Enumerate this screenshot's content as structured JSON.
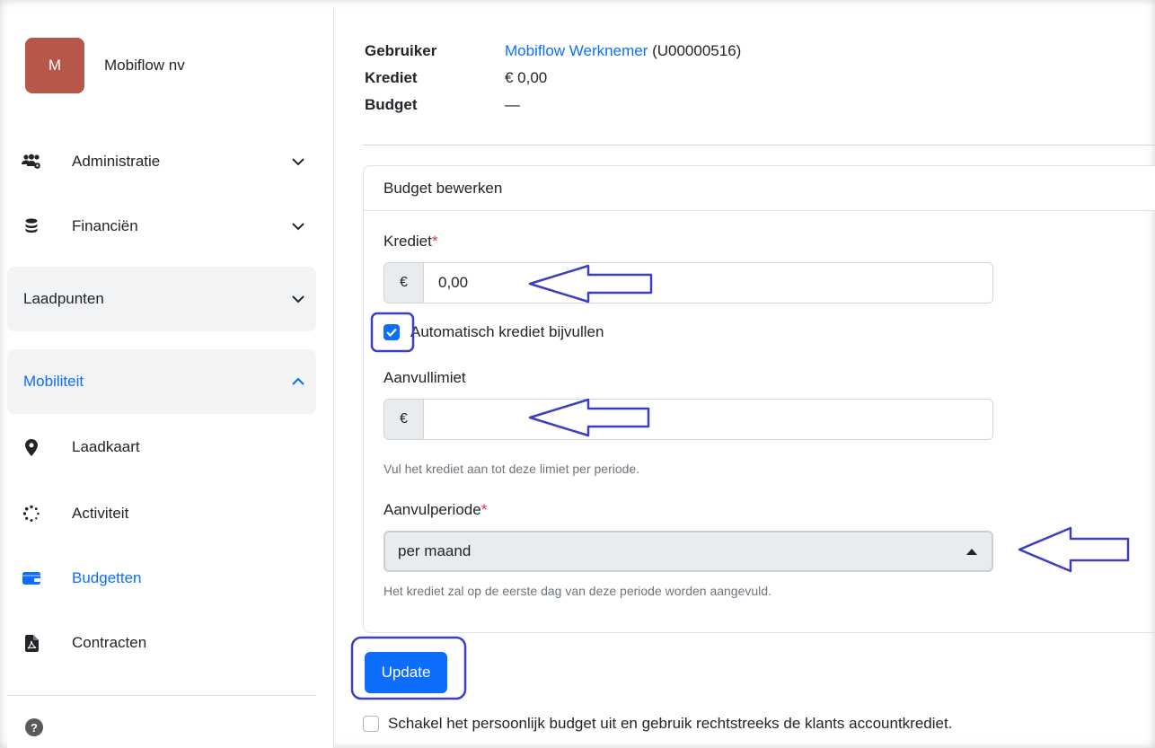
{
  "sidebar": {
    "avatar_letter": "M",
    "org_name": "Mobiflow nv",
    "items": [
      {
        "label": "Administratie",
        "icon": "users-cog-icon"
      },
      {
        "label": "Financiën",
        "icon": "coins-icon"
      },
      {
        "label": "Laadpunten"
      },
      {
        "label": "Mobiliteit"
      },
      {
        "label": "Laadkaart",
        "icon": "map-pin-icon"
      },
      {
        "label": "Activiteit",
        "icon": "spinner-icon"
      },
      {
        "label": "Budgetten",
        "icon": "wallet-icon"
      },
      {
        "label": "Contracten",
        "icon": "file-pdf-icon"
      }
    ],
    "help_glyph": "?"
  },
  "info": {
    "user_label": "Gebruiker",
    "user_name": "Mobiflow Werknemer",
    "user_id": "(U00000516)",
    "credit_label": "Krediet",
    "credit_value": "€ 0,00",
    "budget_label": "Budget",
    "budget_value": "—"
  },
  "form": {
    "card_title": "Budget bewerken",
    "credit_label": "Krediet",
    "required_mark": "*",
    "currency": "€",
    "credit_value": "0,00",
    "auto_refill_label": "Automatisch krediet bijvullen",
    "auto_refill_checked": true,
    "limit_label": "Aanvullimiet",
    "limit_value": "",
    "limit_help": "Vul het krediet aan tot deze limiet per periode.",
    "period_label": "Aanvulperiode",
    "period_value": "per maand",
    "period_help": "Het krediet zal op de eerste dag van deze periode worden aangevuld.",
    "update_label": "Update",
    "disable_personal_label": "Schakel het persoonlijk budget uit en gebruik rechtstreeks de klants accountkrediet."
  },
  "colors": {
    "accent": "#0d6efd",
    "avatar": "#b5584a",
    "annotation": "#3b3fc4"
  }
}
